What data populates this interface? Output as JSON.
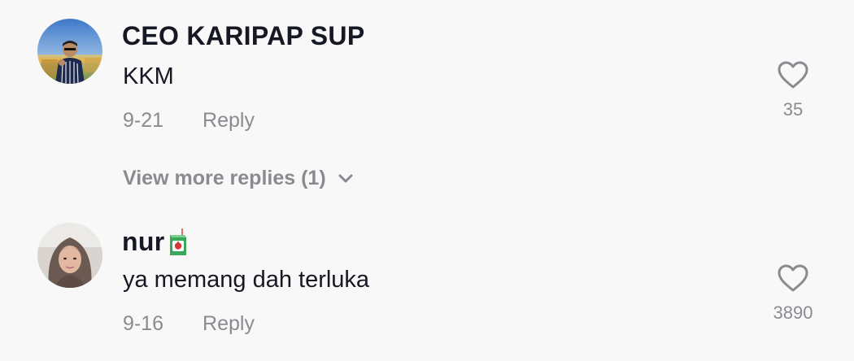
{
  "comments": [
    {
      "username": "CEO KARIPAP SUP",
      "text": "KKM",
      "date": "9-21",
      "reply_label": "Reply",
      "like_count": "35",
      "view_more_label": "View more replies (1)",
      "avatar_icon": "user-avatar-photo"
    },
    {
      "username": "nur",
      "username_emoji": "juice-box-icon",
      "text": "ya memang dah terluka",
      "date": "9-16",
      "reply_label": "Reply",
      "like_count": "3890",
      "avatar_icon": "user-avatar-photo"
    }
  ],
  "colors": {
    "background": "#f8f8f8",
    "username": "#161823",
    "secondary": "#8a8b91",
    "heart_outline": "#8a8b91"
  }
}
